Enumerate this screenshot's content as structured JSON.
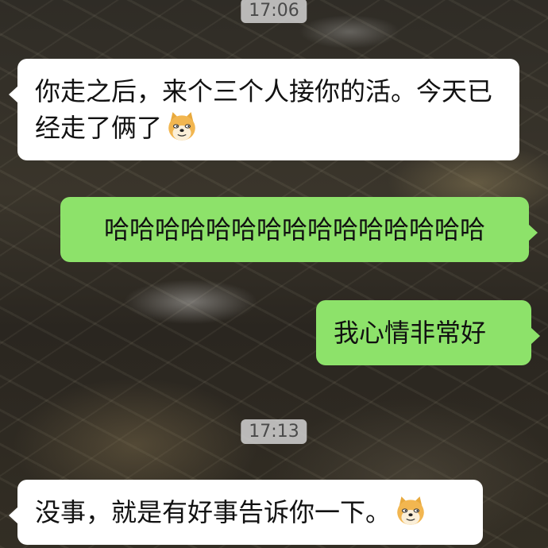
{
  "chat": {
    "timestamps": [
      "17:06",
      "17:13"
    ],
    "messages": [
      {
        "side": "received",
        "text": "你走之后，来个三个人接你的活。今天已经走了俩了",
        "emoji": "doge-emoji"
      },
      {
        "side": "sent",
        "text": "哈哈哈哈哈哈哈哈哈哈哈哈哈哈哈"
      },
      {
        "side": "sent",
        "text": "我心情非常好"
      },
      {
        "side": "received",
        "text": "没事，就是有好事告诉你一下。",
        "emoji": "doge-emoji"
      }
    ]
  },
  "colors": {
    "sent_bubble": "#8de26a",
    "received_bubble": "#ffffff",
    "timestamp_bg": "#d2d2d2"
  }
}
